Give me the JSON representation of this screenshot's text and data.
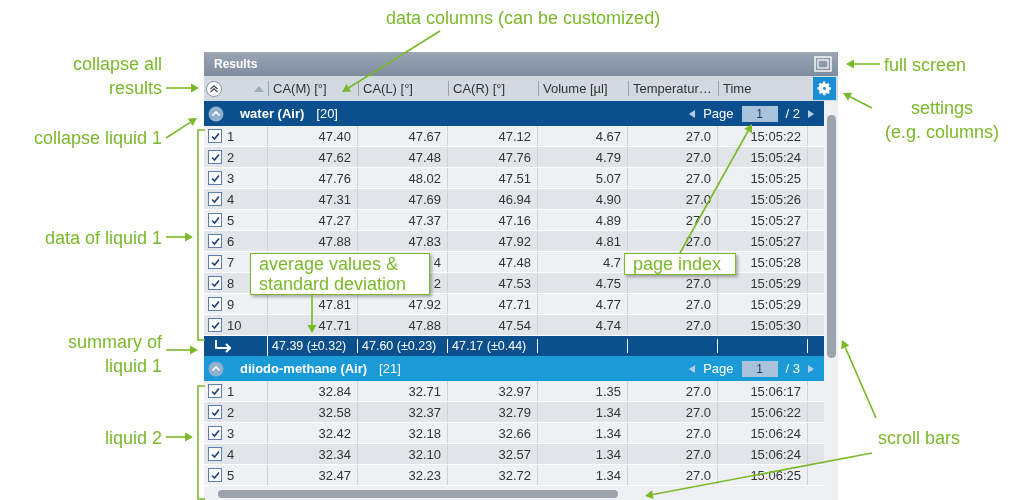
{
  "window": {
    "title": "Results"
  },
  "columns": [
    "CA(M) [°]",
    "CA(L) [°]",
    "CA(R) [°]",
    "Volume [µl]",
    "Temperatur…",
    "Time"
  ],
  "groups": [
    {
      "name": "water (Air)",
      "count": "[20]",
      "selected": true,
      "expanded": true,
      "page_label": "Page",
      "page": "1",
      "page_total": "/ 2",
      "rows": [
        {
          "checked": true,
          "index": "1",
          "cells": [
            "47.40",
            "47.67",
            "47.12",
            "4.67",
            "27.0",
            "15:05:22"
          ]
        },
        {
          "checked": true,
          "index": "2",
          "cells": [
            "47.62",
            "47.48",
            "47.76",
            "4.79",
            "27.0",
            "15:05:24"
          ]
        },
        {
          "checked": true,
          "index": "3",
          "cells": [
            "47.76",
            "48.02",
            "47.51",
            "5.07",
            "27.0",
            "15:05:25"
          ]
        },
        {
          "checked": true,
          "index": "4",
          "cells": [
            "47.31",
            "47.69",
            "46.94",
            "4.90",
            "27.0",
            "15:05:26"
          ]
        },
        {
          "checked": true,
          "index": "5",
          "cells": [
            "47.27",
            "47.37",
            "47.16",
            "4.89",
            "27.0",
            "15:05:27"
          ]
        },
        {
          "checked": true,
          "index": "6",
          "cells": [
            "47.88",
            "47.83",
            "47.92",
            "4.81",
            "27.0",
            "15:05:27"
          ]
        },
        {
          "checked": true,
          "index": "7",
          "cells": [
            null,
            "4",
            "47.48",
            "4.7",
            null,
            "15:05:28"
          ]
        },
        {
          "checked": true,
          "index": "8",
          "cells": [
            null,
            "2",
            "47.53",
            "4.75",
            "27.0",
            "15:05:29"
          ]
        },
        {
          "checked": true,
          "index": "9",
          "cells": [
            "47.81",
            "47.92",
            "47.71",
            "4.77",
            "27.0",
            "15:05:29"
          ]
        },
        {
          "checked": true,
          "index": "10",
          "cells": [
            "47.71",
            "47.88",
            "47.54",
            "4.74",
            "27.0",
            "15:05:30"
          ]
        }
      ],
      "summary": [
        "47.39 (±0.32)",
        "47.60 (±0.23)",
        "47.17 (±0.44)"
      ]
    },
    {
      "name": "diiodo-methane (Air)",
      "count": "[21]",
      "selected": false,
      "expanded": true,
      "page_label": "Page",
      "page": "1",
      "page_total": "/ 3",
      "rows": [
        {
          "checked": true,
          "index": "1",
          "cells": [
            "32.84",
            "32.71",
            "32.97",
            "1.35",
            "27.0",
            "15:06:17"
          ]
        },
        {
          "checked": true,
          "index": "2",
          "cells": [
            "32.58",
            "32.37",
            "32.79",
            "1.34",
            "27.0",
            "15:06:22"
          ]
        },
        {
          "checked": true,
          "index": "3",
          "cells": [
            "32.42",
            "32.18",
            "32.66",
            "1.34",
            "27.0",
            "15:06:24"
          ]
        },
        {
          "checked": true,
          "index": "4",
          "cells": [
            "32.34",
            "32.10",
            "32.57",
            "1.34",
            "27.0",
            "15:06:24"
          ]
        },
        {
          "checked": true,
          "index": "5",
          "cells": [
            "32.47",
            "32.23",
            "32.72",
            "1.34",
            "27.0",
            "15:06:25"
          ]
        }
      ]
    }
  ],
  "annotations": [
    {
      "text": "data columns (can be customized)"
    },
    {
      "text": "collapse all\nresults"
    },
    {
      "text": "collapse liquid 1"
    },
    {
      "text": "data of liquid 1"
    },
    {
      "text": "summary of\nliquid 1"
    },
    {
      "text": "liquid 2"
    },
    {
      "text": "full screen"
    },
    {
      "text": "settings\n(e.g. columns)"
    },
    {
      "text": "scroll bars"
    }
  ],
  "callouts": [
    {
      "text": "average values &\nstandard deviation"
    },
    {
      "text": "page index"
    }
  ]
}
